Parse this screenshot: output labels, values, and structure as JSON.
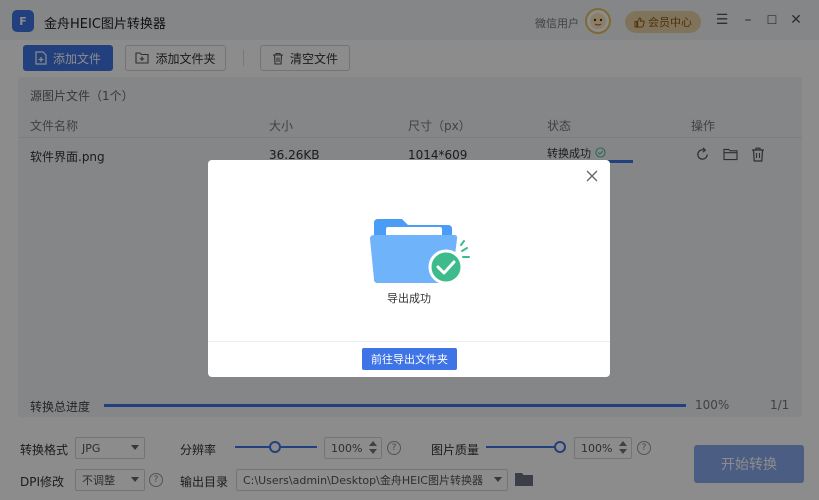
{
  "titlebar": {
    "logo_text": "F",
    "title": "金舟HEIC图片转换器",
    "user_name": "微信用户",
    "member_label": "会员中心",
    "menu_glyph": "☰",
    "min_glyph": "–",
    "max_glyph": "☐",
    "close_glyph": "✕"
  },
  "toolbar": {
    "add_file": "添加文件",
    "add_folder": "添加文件夹",
    "clear_files": "清空文件"
  },
  "file_panel": {
    "title": "源图片文件（1个）",
    "columns": {
      "name": "文件名称",
      "size": "大小",
      "dimensions": "尺寸（px）",
      "status": "状态",
      "actions": "操作"
    },
    "rows": [
      {
        "name": "软件界面.png",
        "size": "36.26KB",
        "dimensions": "1014*609",
        "status": "转换成功"
      }
    ]
  },
  "progress": {
    "label": "转换总进度",
    "value_fraction": 1.0,
    "percent_text": "100%",
    "count_text": "1/1"
  },
  "settings": {
    "format_label": "转换格式",
    "format_value": "JPG",
    "resolution_label": "分辨率",
    "resolution_value": "100",
    "resolution_unit": "%",
    "quality_label": "图片质量",
    "quality_value": "100",
    "quality_unit": "%",
    "dpi_label": "DPI修改",
    "dpi_value": "不调整",
    "output_label": "输出目录",
    "output_path": "C:\\Users\\admin\\Desktop\\金舟HEIC图片转换器",
    "help_glyph": "?"
  },
  "start_button": "开始转换",
  "dialog": {
    "message": "导出成功",
    "action_button": "前往导出文件夹"
  },
  "colors": {
    "accent": "#3e74e6",
    "success": "#3dbb8c",
    "folder": "#4b9cf5"
  }
}
